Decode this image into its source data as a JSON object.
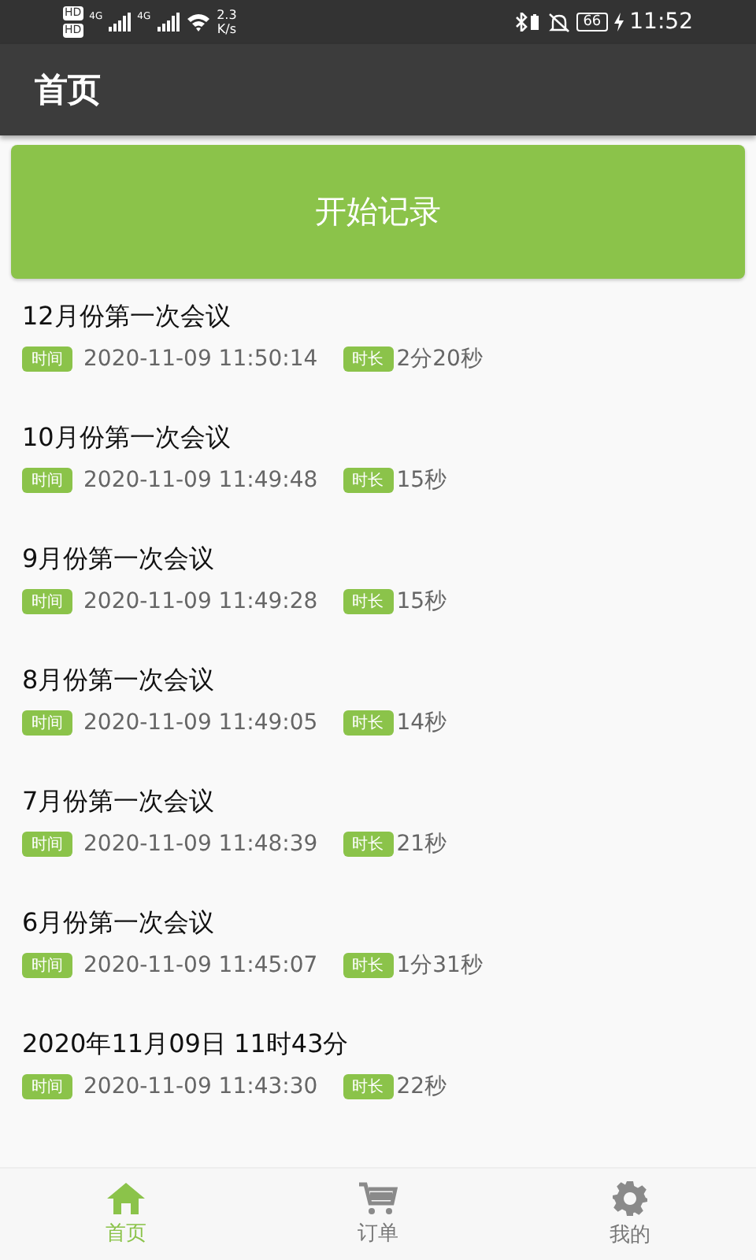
{
  "status_bar": {
    "hd_labels": [
      "HD",
      "HD"
    ],
    "network_labels": [
      "4G",
      "4G"
    ],
    "speed": [
      "2.3",
      "K/s"
    ],
    "battery": "66",
    "time": "11:52"
  },
  "header": {
    "title": "首页"
  },
  "record_button": "开始记录",
  "meetings": [
    {
      "title": "12月份第一次会议",
      "time_tag": "时间",
      "time": "2020-11-09 11:50:14",
      "duration_tag": "时长",
      "duration": "2分20秒"
    },
    {
      "title": "10月份第一次会议",
      "time_tag": "时间",
      "time": "2020-11-09 11:49:48",
      "duration_tag": "时长",
      "duration": "15秒"
    },
    {
      "title": "9月份第一次会议",
      "time_tag": "时间",
      "time": "2020-11-09 11:49:28",
      "duration_tag": "时长",
      "duration": "15秒"
    },
    {
      "title": "8月份第一次会议",
      "time_tag": "时间",
      "time": "2020-11-09 11:49:05",
      "duration_tag": "时长",
      "duration": "14秒"
    },
    {
      "title": "7月份第一次会议",
      "time_tag": "时间",
      "time": "2020-11-09 11:48:39",
      "duration_tag": "时长",
      "duration": "21秒"
    },
    {
      "title": "6月份第一次会议",
      "time_tag": "时间",
      "time": "2020-11-09 11:45:07",
      "duration_tag": "时长",
      "duration": "1分31秒"
    },
    {
      "title": "2020年11月09日 11时43分",
      "time_tag": "时间",
      "time": "2020-11-09 11:43:30",
      "duration_tag": "时长",
      "duration": "22秒"
    }
  ],
  "tabs": [
    {
      "label": "首页",
      "kind": "home",
      "selected": true
    },
    {
      "label": "订单",
      "kind": "cart",
      "selected": false
    },
    {
      "label": "我的",
      "kind": "gear",
      "selected": false
    }
  ]
}
